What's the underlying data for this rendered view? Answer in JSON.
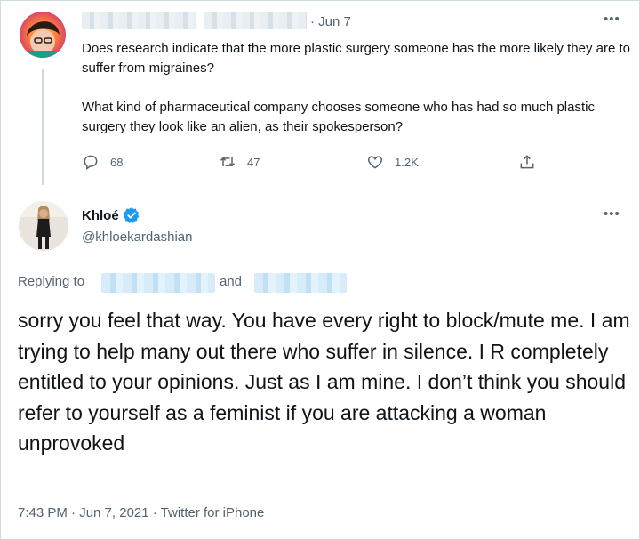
{
  "tweet1": {
    "date": "· Jun 7",
    "more_label": "•••",
    "paragraph1": "Does research indicate that the more plastic surgery someone has the more likely they are to suffer from migraines?",
    "paragraph2": "What kind of pharmaceutical company chooses someone who has had so much plastic surgery they look like an alien, as their spokesperson?",
    "actions": {
      "reply_count": "68",
      "retweet_count": "47",
      "like_count": "1.2K"
    },
    "icons": [
      "reply-icon",
      "retweet-icon",
      "like-icon",
      "share-icon"
    ]
  },
  "tweet2": {
    "name": "Khloé",
    "handle": "@khloekardashian",
    "more_label": "•••",
    "replying_to_label": "Replying to",
    "and_label": "and",
    "text": "sorry you feel that way. You have every right to block/mute me. I am trying to help many out there who suffer in silence. I R completely entitled to your opinions. Just as I am mine. I don’t think you should refer to yourself as a feminist if you are attacking a woman unprovoked",
    "timestamp": "7:43 PM · Jun 7, 2021 · Twitter for iPhone",
    "icons": [
      "verified-badge-icon"
    ]
  },
  "colors": {
    "text": "#0f1419",
    "secondary": "#536471",
    "accent": "#1d9bf0",
    "border": "#cfd9de"
  }
}
